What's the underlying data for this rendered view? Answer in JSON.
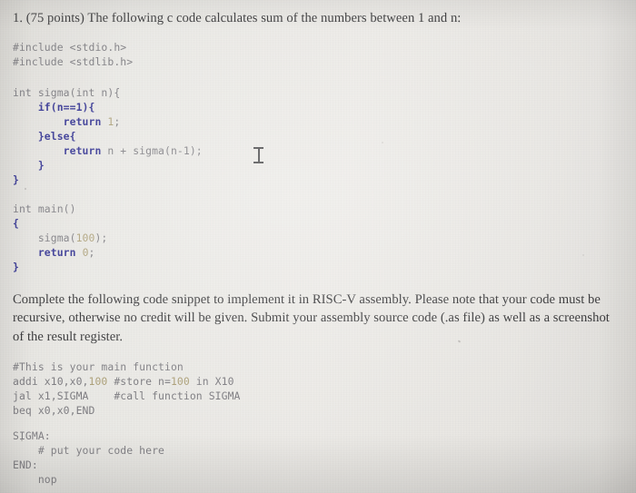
{
  "document": {
    "type": "exam-question-photo",
    "heading": "1. (75 points) The following c code calculates sum of the numbers between 1 and n:",
    "instruction": "Complete the following code snippet to implement it in RISC-V assembly. Please note that your code must be recursive, otherwise no credit will be given. Submit your assembly source code (.as file) as well as a screenshot of the result register."
  },
  "c_code": {
    "includes": [
      "#include <stdio.h>",
      "#include <stdlib.h>"
    ],
    "sigma_function": {
      "signature_type": "int",
      "signature_rest": " sigma(int n){",
      "if_keyword": "if",
      "if_condition": "(n==1){",
      "return1_keyword": "return",
      "return1_value": "1",
      "return1_semicolon": ";",
      "else_line": "}else{",
      "return2_keyword": "return",
      "return2_expr": " n + sigma(n-1);",
      "inner_close": "}",
      "outer_close": "}"
    },
    "main_function": {
      "signature_type": "int",
      "signature_rest": " main()",
      "open_brace": "{",
      "call_name": "sigma(",
      "call_arg": "100",
      "call_tail": ");",
      "return_keyword": "return",
      "return_value": "0",
      "return_semicolon": ";",
      "close_brace": "}"
    }
  },
  "asm_code": {
    "main_block": {
      "comment_header": "#This is your main function",
      "line2_pre": "addi x10,x0,",
      "line2_imm": "100",
      "line2_mid": " #store n=",
      "line2_imm2": "100",
      "line2_post": " in X10",
      "line3": "jal x1,SIGMA    #call function SIGMA",
      "line4": "beq x0,x0,END"
    },
    "labels_block": {
      "sigma_label": "SIGMA:",
      "placeholder_comment": "    # put your code here",
      "end_label": "END:",
      "nop": "    nop"
    }
  },
  "cursor": {
    "kind": "text-ibeam-cursor"
  },
  "colors": {
    "paper": "#eceae6",
    "body_text": "#2b2b2d",
    "code_plain": "#76757a",
    "code_keyword": "#2a2a8c",
    "code_number": "#a79a70"
  }
}
